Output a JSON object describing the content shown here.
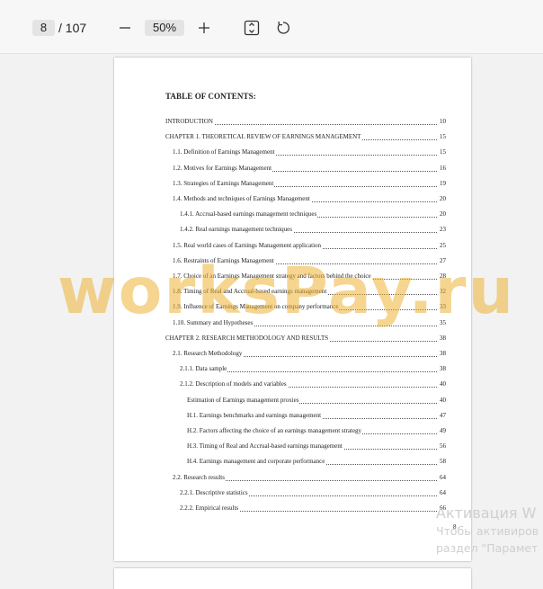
{
  "toolbar": {
    "current_page": "8",
    "total_pages": "/ 107",
    "zoom": "50%",
    "zoom_out_icon": "minus-icon",
    "zoom_in_icon": "plus-icon",
    "fit_icon": "fit-page-icon",
    "rotate_icon": "rotate-icon"
  },
  "document": {
    "title": "TABLE OF CONTENTS:",
    "page_number": "8",
    "toc": [
      {
        "text": "INTRODUCTION",
        "page": "10",
        "level": 0
      },
      {
        "text": "CHAPTER 1. THEORETICAL REVIEW OF EARNINGS MANAGEMENT",
        "page": "15",
        "level": 0
      },
      {
        "text": "1.1. Definition of Earnings Management",
        "page": "15",
        "level": 1
      },
      {
        "text": "1.2. Motives for Earnings Management",
        "page": "16",
        "level": 1
      },
      {
        "text": "1.3. Strategies of Earnings Management",
        "page": "19",
        "level": 1
      },
      {
        "text": "1.4. Methods and techniques of Earnings Management",
        "page": "20",
        "level": 1
      },
      {
        "text": "1.4.1. Accrual-based earnings management techniques",
        "page": "20",
        "level": 2
      },
      {
        "text": "1.4.2. Real earnings management techniques",
        "page": "23",
        "level": 2
      },
      {
        "text": "1.5. Real world cases of Earnings Management application",
        "page": "25",
        "level": 1
      },
      {
        "text": "1.6. Restraints of Earnings Management",
        "page": "27",
        "level": 1
      },
      {
        "text": "1.7. Choice of an Earnings Management strategy and factors behind the choice",
        "page": "28",
        "level": 1
      },
      {
        "text": "1.8. Timing of Real and Accrual-based earnings management",
        "page": "32",
        "level": 1
      },
      {
        "text": "1.9. Influence of Earnings Management on company performance",
        "page": "33",
        "level": 1
      },
      {
        "text": "1.10. Summary and Hypotheses",
        "page": "35",
        "level": 1
      },
      {
        "text": "CHAPTER 2. RESEARCH METHODOLOGY AND RESULTS",
        "page": "38",
        "level": 0
      },
      {
        "text": "2.1. Research Methodology",
        "page": "38",
        "level": 1
      },
      {
        "text": "2.1.1. Data sample",
        "page": "38",
        "level": 2
      },
      {
        "text": "2.1.2. Description of models and variables",
        "page": "40",
        "level": 2
      },
      {
        "text": "Estimation of Earnings management proxies",
        "page": "40",
        "level": 3
      },
      {
        "text": "H.1. Earnings benchmarks and earnings management",
        "page": "47",
        "level": 3
      },
      {
        "text": "H.2. Factors affecting the choice of an earnings management strategy",
        "page": "49",
        "level": 3
      },
      {
        "text": "H.3. Timing of Real and Accrual-based earnings management",
        "page": "56",
        "level": 3
      },
      {
        "text": "H.4. Earnings management and corporate performance",
        "page": "58",
        "level": 3
      },
      {
        "text": "2.2. Research results",
        "page": "64",
        "level": 1
      },
      {
        "text": "2.2.1. Descriptive statistics",
        "page": "64",
        "level": 2
      },
      {
        "text": "2.2.2. Empirical results",
        "page": "66",
        "level": 2
      }
    ]
  },
  "watermark": "worksPay.ru",
  "os_activation": {
    "line1": "Активация W",
    "line2": "Чтобы активиров",
    "line3": "раздел \"Парамет"
  }
}
